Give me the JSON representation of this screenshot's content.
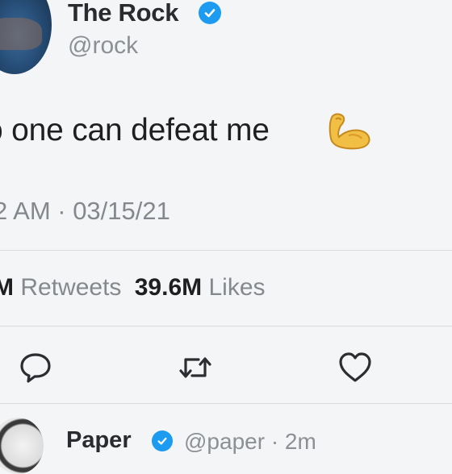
{
  "tweet": {
    "author_name": "The Rock",
    "author_handle": "@rock",
    "text": "o one can defeat me",
    "emoji": "flexed-biceps",
    "timestamp": "2 AM · 03/15/21",
    "retweets_label_prefix": "M",
    "retweets_label": "Retweets",
    "likes_count": "39.6M",
    "likes_label": "Likes"
  },
  "reply": {
    "author_name": "Paper",
    "meta": "@paper · 2m"
  },
  "colors": {
    "verified": "#1d9bf0",
    "text": "#1f1f22",
    "muted": "#85898e"
  },
  "icons": [
    "verified-badge-icon",
    "flexed-biceps-icon",
    "reply-icon",
    "retweet-icon",
    "like-icon"
  ]
}
